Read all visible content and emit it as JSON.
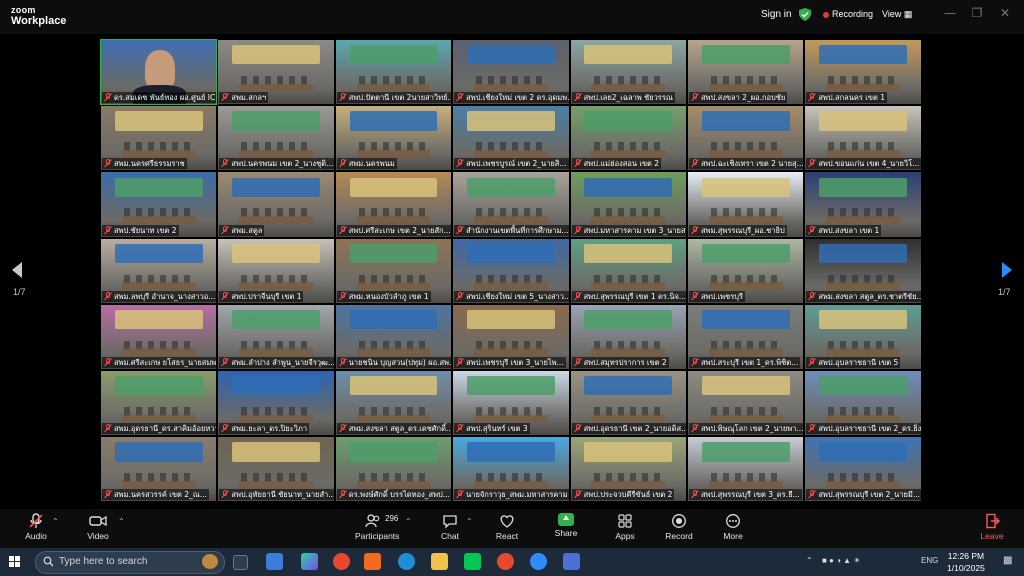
{
  "app": {
    "logo_line1": "zoom",
    "logo_line2": "Workplace"
  },
  "topbar": {
    "signin": "Sign in",
    "recording": "Recording",
    "view": "View"
  },
  "pager": {
    "left": "1/7",
    "right": "1/7"
  },
  "tiles": [
    "ดร.สมเดช พันธ์ทอง ผอ.ศูนย์ ICT...",
    "สพม.สกลฯ",
    "สพป.ปัตตานี เขต 2นายสาวิทย์...",
    "สพป.เชียงใหม่ เขต 2 ดร.อุดมพร จิ...",
    "สพป.เลย2_เฉลาพ ชัยวรรณ",
    "สพป.สงขลา 2_ผอ.กอบชัย",
    "สพป.สกลนคร เขต 1",
    "สพม.นครศรีธรรมราช",
    "สพป.นครพนม เขต 2_นางชุติ...",
    "สพม.นครพนม",
    "สพป.เพชรบูรณ์ เขต 2_นายสิ...",
    "สพป.แม่ฮ่องสอน เขต 2",
    "สพป.ฉะเชิงเทรา เขต 2 นายสุ...",
    "สพป.ขอนแก่น เขต 4_นายวิโ...",
    "สพป.ชัยนาท เขต 2",
    "สพม.สตูล",
    "สพป.ศรีสะเกษ เขต 2_นายสัก...",
    "สำนักงานเขตพื้นที่การศึกษาม...",
    "สพป.มหาสารคาม เขต 3_นายส...",
    "สพม.สุพรรณบุรี_ผอ.ชาธิป",
    "สพป.สงขลา เขต 1",
    "สพม.ลพบุรี อำนาจ_นางสาวอ...",
    "สพป.ปราจีนบุรี เขต 1",
    "สพม.หนองบัวลำภู เขต 1",
    "สพป.เชียงใหม่ เขต 5_นางสาว...",
    "สพป.สุพรรณบุรี เขต 1 ดร.นิจ...",
    "สพป.เพชรบุรี",
    "สพม.สงขลา สตูล_ดร.ชาตรีชัย...",
    "สพม.ศรีสะเกษ ยโสธร_นายสมพ...",
    "สพม.ลำปาง ลำพูน_นายจีรวุฒ...",
    "นายชนิน บุญสวน(ปทุม) ผอ.สพม...",
    "สพป.เพชรบุรี เขต 3_นายไพ...",
    "สพป.สมุทรปราการ เขต 2",
    "สพป.สระบุรี เขต 1_ดร.พิชิต...",
    "สพป.อุบลราชธานี เขต 5",
    "สพม.อุดรธานี_ดร.สาคิมอ้อยหวาน",
    "สพม.ยะลา_ดร.ปิยะวิภา",
    "สพม.สงขลา สตูล_ดร.เดชศักดิ์...",
    "สพป.สุรินทร์ เขต 3",
    "สพป.อุดรธานี เขต 2_นายอดิส...",
    "สพป.พิษณุโลก เขต 2_นายพา...",
    "สพป.อุบลราชธานี เขต 2_ดร.ยิ่ง...",
    "สพม.นครสวรรค์ เขต 2_ณ...",
    "สพป.อุทัยธานี ชัยนาท_นายสำ...",
    "ดร.พงษ์ศักดิ์ บรรไดทอง_สพป...",
    "นายจักราวุธ_สพม.มหาสารคาม",
    "สพป.ประจวบคีรีขันธ์ เขต 2",
    "สพป.สุพรรณบุรี เขต 3_ดร.ธี...",
    "สพป.สุพรรณบุรี เขต 2_นายมี..."
  ],
  "tile_colors": [
    "#3d6fb4",
    "#8c8a86",
    "#5aa7b0",
    "#5d6170",
    "#8aa6a3",
    "#b7a48a",
    "#c59a5a",
    "#8a7a66",
    "#9b9a94",
    "#c7b07a",
    "#4a7fa6",
    "#74a06a",
    "#a68d68",
    "#c9c4bc",
    "#3a6ca8",
    "#9c8a70",
    "#b58a54",
    "#a9a39a",
    "#6c9e5a",
    "#e8eef6",
    "#2b3f74",
    "#b9aea0",
    "#c7c2b8",
    "#8e7456",
    "#3f69a6",
    "#5ea084",
    "#aeb8a3",
    "#2f2f30",
    "#b96ca6",
    "#a2a7ac",
    "#4e74a0",
    "#8a6a4c",
    "#9aa4b6",
    "#7a7e7a",
    "#5c9e94",
    "#8a9c6a",
    "#2d63b2",
    "#6f8fa8",
    "#cbd8e6",
    "#9b9284",
    "#8e8a84",
    "#6c8ebd",
    "#8a7c6a",
    "#6e6452",
    "#6b9e6e",
    "#49a9e0",
    "#9aa678",
    "#c7ccd4",
    "#3f74b2"
  ],
  "toolbar": {
    "audio": "Audio",
    "video": "Video",
    "participants": "Participants",
    "participants_count": "296",
    "chat": "Chat",
    "react": "React",
    "share": "Share",
    "apps": "Apps",
    "record": "Record",
    "more": "More",
    "leave": "Leave"
  },
  "taskbar": {
    "search_placeholder": "Type here to search",
    "lang": "ENG",
    "time": "12:26 PM",
    "date": "1/10/2025"
  }
}
